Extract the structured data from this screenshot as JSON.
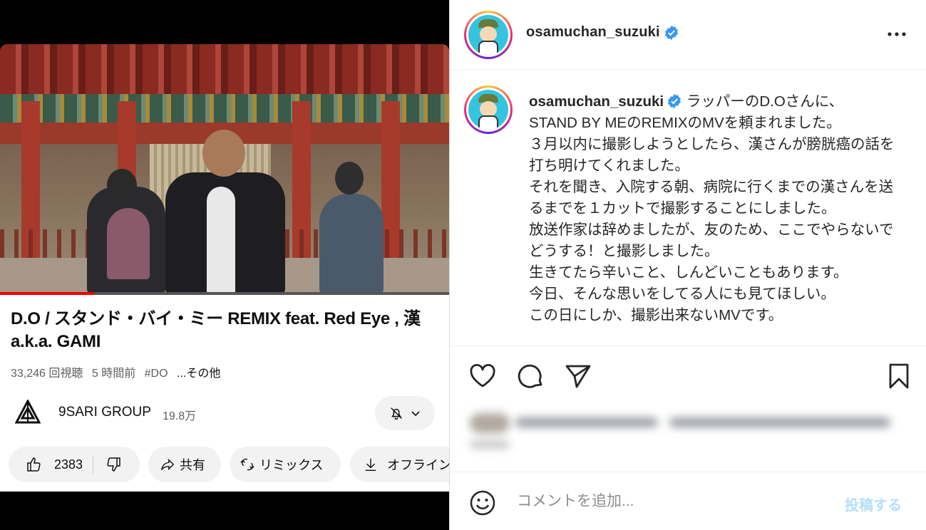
{
  "youtube": {
    "video": {
      "progress_fraction": 0.21
    },
    "title": "D.O / スタンド・バイ・ミー REMIX feat. Red Eye , 漢 a.k.a. GAMI",
    "meta": {
      "views": "33,246 回視聴",
      "time": "5 時間前",
      "hashtag": "#DO",
      "more": "...その他"
    },
    "channel": {
      "name": "9SARI GROUP",
      "subscribers": "19.8万"
    },
    "actions": {
      "likes": "2383",
      "share": "共有",
      "remix": "リミックス",
      "offline": "オフライン"
    }
  },
  "instagram": {
    "username": "osamuchan_suzuki",
    "caption_username": "osamuchan_suzuki",
    "caption": " ラッパーのD.Oさんに、\nSTAND BY MEのREMIXのMVを頼まれました。\n３月以内に撮影しようとしたら、漢さんが膀胱癌の話を打ち明けてくれました。\nそれを聞き、入院する朝、病院に行くまでの漢さんを送るまでを１カットで撮影することにしました。\n放送作家は辞めましたが、友のため、ここでやらないでどうする！と撮影しました。\n生きてたら辛いこと、しんどいこともあります。\n今日、そんな思いをしてる人にも見てほしい。\nこの日にしか、撮影出来ないMVです。",
    "comment_placeholder": "コメントを追加...",
    "post_label": "投稿する",
    "colors": {
      "verified": "#3897f0",
      "post": "#b2dffc",
      "ring_start": "#f9ce34",
      "ring_mid": "#ee2a7b"
    }
  }
}
